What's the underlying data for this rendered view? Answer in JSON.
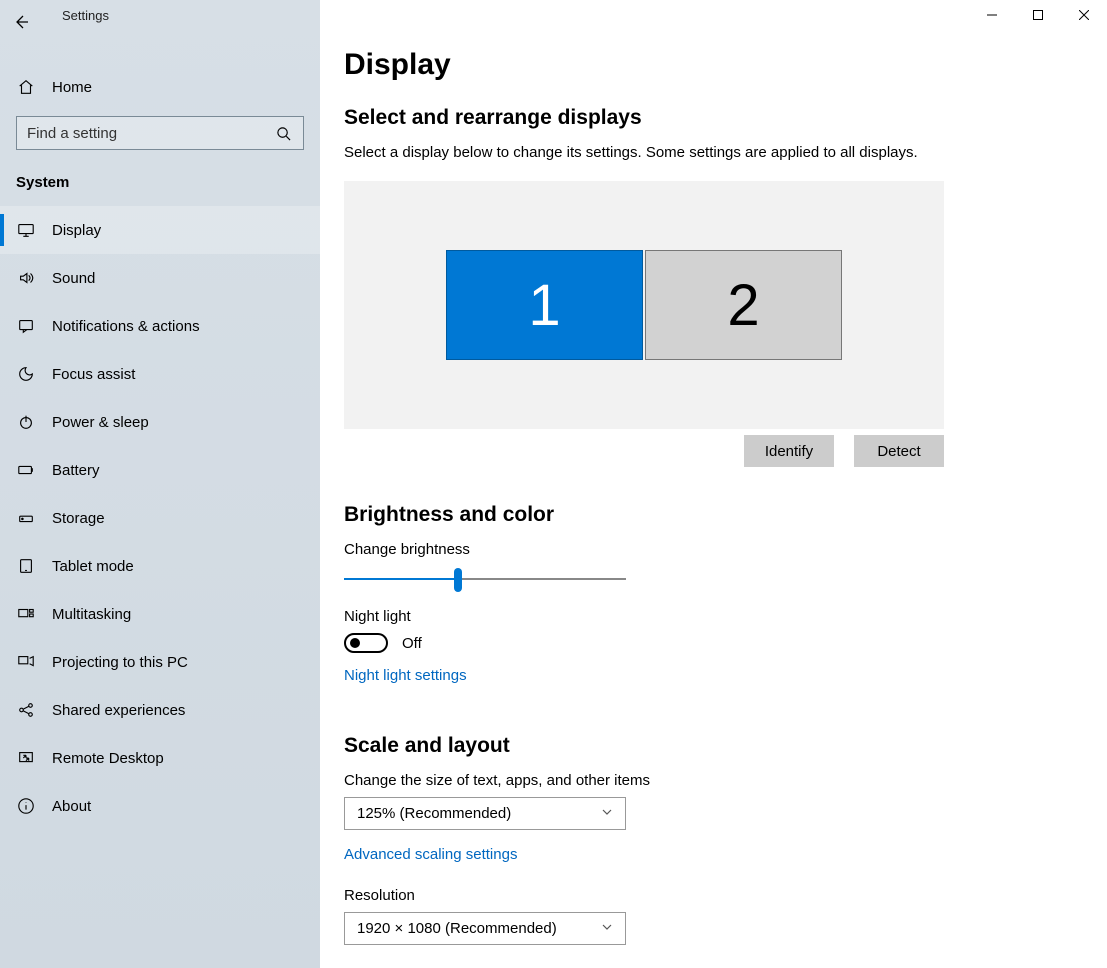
{
  "window": {
    "title": "Settings"
  },
  "sidebar": {
    "home_label": "Home",
    "search_placeholder": "Find a setting",
    "category": "System",
    "items": [
      {
        "label": "Display",
        "selected": true
      },
      {
        "label": "Sound",
        "selected": false
      },
      {
        "label": "Notifications & actions",
        "selected": false
      },
      {
        "label": "Focus assist",
        "selected": false
      },
      {
        "label": "Power & sleep",
        "selected": false
      },
      {
        "label": "Battery",
        "selected": false
      },
      {
        "label": "Storage",
        "selected": false
      },
      {
        "label": "Tablet mode",
        "selected": false
      },
      {
        "label": "Multitasking",
        "selected": false
      },
      {
        "label": "Projecting to this PC",
        "selected": false
      },
      {
        "label": "Shared experiences",
        "selected": false
      },
      {
        "label": "Remote Desktop",
        "selected": false
      },
      {
        "label": "About",
        "selected": false
      }
    ]
  },
  "page": {
    "title": "Display",
    "arrange": {
      "heading": "Select and rearrange displays",
      "description": "Select a display below to change its settings. Some settings are applied to all displays.",
      "displays": [
        {
          "id": "1",
          "selected": true
        },
        {
          "id": "2",
          "selected": false
        }
      ],
      "identify_label": "Identify",
      "detect_label": "Detect"
    },
    "brightness": {
      "heading": "Brightness and color",
      "slider_label": "Change brightness",
      "slider_value_percent": 40,
      "night_light_label": "Night light",
      "night_light_state": "Off",
      "night_light_link": "Night light settings"
    },
    "scale": {
      "heading": "Scale and layout",
      "scale_label": "Change the size of text, apps, and other items",
      "scale_value": "125% (Recommended)",
      "advanced_link": "Advanced scaling settings",
      "resolution_label": "Resolution",
      "resolution_value": "1920 × 1080 (Recommended)"
    }
  }
}
